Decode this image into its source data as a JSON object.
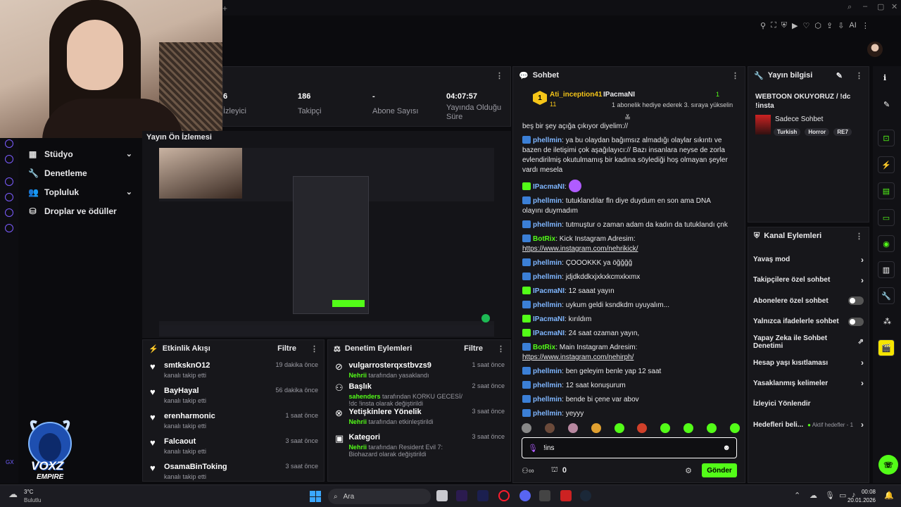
{
  "nav": {
    "items": [
      {
        "label": "Stüdyo",
        "icon": "studio-icon",
        "chevron": true
      },
      {
        "label": "Denetleme",
        "icon": "wrench-icon",
        "chevron": false
      },
      {
        "label": "Topluluk",
        "icon": "community-icon",
        "chevron": true
      },
      {
        "label": "Droplar ve ödüller",
        "icon": "drops-icon",
        "chevron": false
      }
    ]
  },
  "logo": {
    "line1": "VOXZ",
    "line2": "EMPIRE"
  },
  "stats": [
    {
      "value": "6",
      "label": "İzleyici"
    },
    {
      "value": "186",
      "label": "Takipçi"
    },
    {
      "value": "-",
      "label": "Abone Sayısı"
    },
    {
      "value": "04:07:57",
      "label": "Yayında Olduğu Süre"
    }
  ],
  "preview": {
    "title": "Yayın Ön İzlemesi"
  },
  "activity": {
    "title": "Etkinlik Akışı",
    "filter": "Filtre",
    "items": [
      {
        "name": "smtksknO12",
        "sub": "kanalı takip etti",
        "time": "19 dakika önce"
      },
      {
        "name": "BayHayal",
        "sub": "kanalı takip etti",
        "time": "56 dakika önce"
      },
      {
        "name": "erenharmonic",
        "sub": "kanalı takip etti",
        "time": "1 saat önce"
      },
      {
        "name": "Falcaout",
        "sub": "kanalı takip etti",
        "time": "3 saat önce"
      },
      {
        "name": "OsamaBinToking",
        "sub": "kanalı takip etti",
        "time": "3 saat önce"
      }
    ]
  },
  "moderation": {
    "title": "Denetim Eylemleri",
    "filter": "Filtre",
    "items": [
      {
        "name": "vulgarrosterqxstbvzs9",
        "actor": "Nehrii",
        "text": "tarafından yasaklandı",
        "time": "1 saat önce"
      },
      {
        "name": "Başlık",
        "actor": "sahenders",
        "text": "tarafından KORKU GECESİ/ !dc !insta olarak değiştirildi",
        "time": "2 saat önce"
      },
      {
        "name": "Yetişkinlere Yönelik",
        "actor": "Nehrii",
        "text": "tarafından etkinleştirildi",
        "time": "3 saat önce"
      },
      {
        "name": "Kategori",
        "actor": "Nehrii",
        "text": "tarafından Resident Evil 7: Biohazard olarak değiştirildi",
        "time": "3 saat önce"
      }
    ]
  },
  "chat": {
    "title": "Sohbet",
    "pinned": {
      "gifter": "Ati_inception41",
      "gifter_count": "11",
      "rank": "1",
      "recipient": "IPacmaNI",
      "recipient_count": "1",
      "message": "1 abonelik hediye ederek 3. sıraya yükselin"
    },
    "messages": [
      {
        "user": "",
        "text": "beş bir şey açığa çıkıyor diyelim://",
        "color": "#e8e8ea",
        "badge": ""
      },
      {
        "user": "phellmin",
        "text": "ya bu olaydan bağımsız almadığı olaylar sıkıntı ve bazen de iletişimi çok aşağılayıcı:// Bazı insanlara neyse de zorla evlendirilmiş okutulmamış bir kadına söylediği hoş olmayan şeyler vardı mesela",
        "color": "#7fb6ff",
        "badge": "blue"
      },
      {
        "user": "IPacmaNI",
        "text": "",
        "color": "#7fb6ff",
        "badge": "green",
        "emote": true
      },
      {
        "user": "phellmin",
        "text": "tutuklandılar fln diye duydum en son ama DNA olayını duymadım",
        "color": "#7fb6ff",
        "badge": "blue"
      },
      {
        "user": "phellmin",
        "text": "tutmuştur o zaman adam da kadın da tutuklandı çnk",
        "color": "#7fb6ff",
        "badge": "blue"
      },
      {
        "user": "BotRix",
        "text": "Kick Instagram Adresim:",
        "link": "https://www.instagram.com/nehrikick/",
        "color": "#53fc18",
        "badge": "blue"
      },
      {
        "user": "phellmin",
        "text": "ÇOOOKKK ya öğğğğ",
        "color": "#7fb6ff",
        "badge": "blue"
      },
      {
        "user": "phellmin",
        "text": "jdjdkddkxjxkxkcmxkxmx",
        "color": "#7fb6ff",
        "badge": "blue"
      },
      {
        "user": "IPacmaNI",
        "text": "12 saaat yayın",
        "color": "#7fb6ff",
        "badge": "green"
      },
      {
        "user": "phellmin",
        "text": "uykum geldi ksndkdm uyuyalım...",
        "color": "#7fb6ff",
        "badge": "blue"
      },
      {
        "user": "IPacmaNI",
        "text": "kırıldım",
        "color": "#7fb6ff",
        "badge": "green"
      },
      {
        "user": "IPacmaNI",
        "text": "24 saat ozaman yayın,",
        "color": "#7fb6ff",
        "badge": "green"
      },
      {
        "user": "BotRix",
        "text": "Main Instagram Adresim:",
        "link": "https://www.instagram.com/nehirph/",
        "color": "#53fc18",
        "badge": "blue"
      },
      {
        "user": "phellmin",
        "text": "ben geleyim benle yap 12 saat",
        "color": "#7fb6ff",
        "badge": "blue"
      },
      {
        "user": "phellmin",
        "text": "12 saat konuşurum",
        "color": "#7fb6ff",
        "badge": "blue"
      },
      {
        "user": "phellmin",
        "text": "bende bi çene var abov",
        "color": "#7fb6ff",
        "badge": "blue"
      },
      {
        "user": "phellmin",
        "text": "yeyyy",
        "color": "#7fb6ff",
        "badge": "blue"
      }
    ],
    "input_value": "!ins",
    "points": "0",
    "send_label": "Gönder"
  },
  "info": {
    "title": "Yayın bilgisi",
    "stream_title": "WEBTOON OKUYORUZ / !dc !insta",
    "category": "Sadece Sohbet",
    "tags": [
      "Turkish",
      "Horror",
      "RE7"
    ]
  },
  "actions": {
    "title": "Kanal Eylemleri",
    "items": [
      {
        "label": "Yavaş mod",
        "type": "chevron"
      },
      {
        "label": "Takipçilere özel sohbet",
        "type": "chevron"
      },
      {
        "label": "Abonelere özel sohbet",
        "type": "toggle"
      },
      {
        "label": "Yalnızca ifadelerle sohbet",
        "type": "toggle"
      },
      {
        "label": "Yapay Zeka ile Sohbet Denetimi",
        "type": "external"
      },
      {
        "label": "Hesap yaşı kısıtlaması",
        "type": "chevron"
      },
      {
        "label": "Yasaklanmış kelimeler",
        "type": "chevron"
      },
      {
        "label": "İzleyici Yönlendir",
        "type": "none"
      },
      {
        "label": "Hedefleri beli...",
        "type": "goal",
        "extra": "Aktif hedefler - 1"
      }
    ]
  },
  "taskbar": {
    "weather_temp": "3°C",
    "weather_desc": "Bulutlu",
    "search_placeholder": "Ara",
    "time": "00:08",
    "date": "20.01.2026"
  },
  "colors": {
    "accent": "#53fc18",
    "panel": "#17171b",
    "bg": "#0b0b0e"
  }
}
